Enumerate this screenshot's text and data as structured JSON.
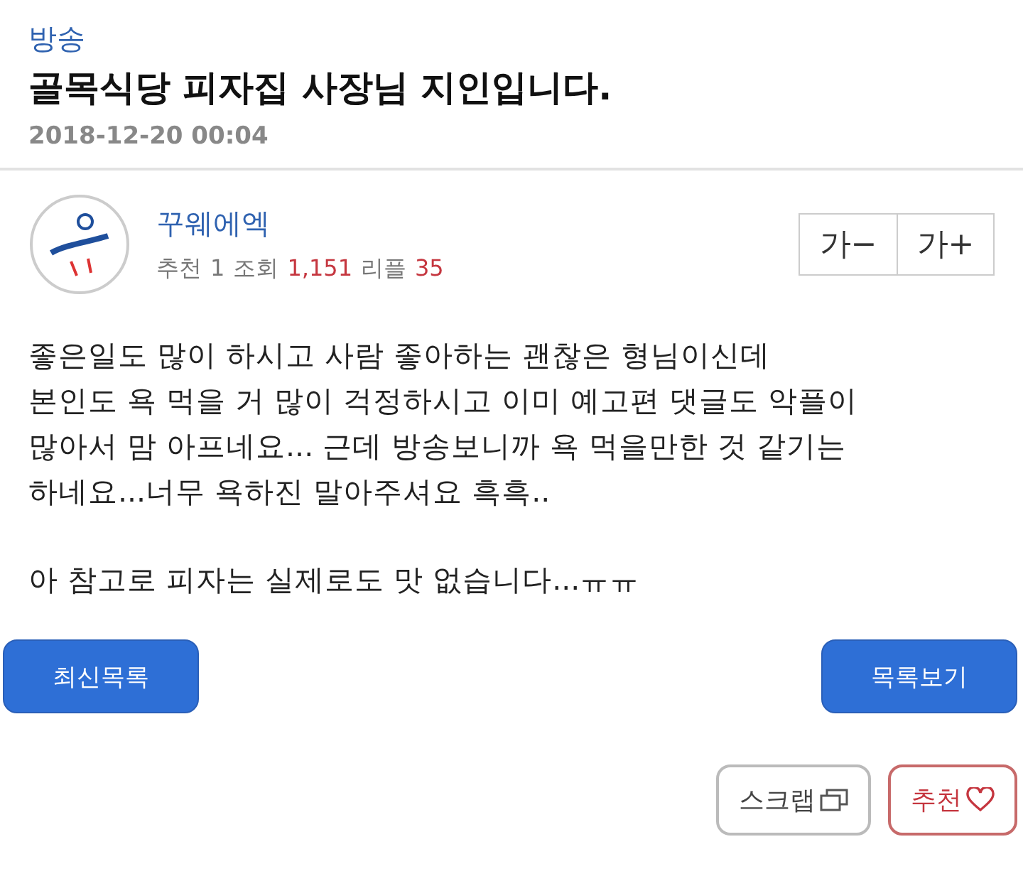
{
  "category": "방송",
  "title": "골목식당 피자집 사장님 지인입니다.",
  "date": "2018-12-20 00:04",
  "author": {
    "name": "꾸웨에엑",
    "stats": [
      {
        "label": "추천",
        "value": "1",
        "highlight": false
      },
      {
        "label": "조회",
        "value": "1,151",
        "highlight": true
      },
      {
        "label": "리플",
        "value": "35",
        "highlight": true
      }
    ]
  },
  "font_buttons": [
    "가−",
    "가+"
  ],
  "body": [
    {
      "lines": [
        "좋은일도 많이 하시고 사람 좋아하는 괜찮은 형님이신데",
        "본인도 욕 먹을 거 많이 걱정하시고 이미 예고편 댓글도 악플이",
        "많아서 맘 아프네요... 근데 방송보니까 욕 먹을만한 것 같기는",
        "하네요...너무 욕하진 말아주셔요 흑흑.."
      ]
    },
    {
      "lines": [
        "아 참고로 피자는 실제로도 맛 없습니다...ㅠㅠ"
      ]
    }
  ],
  "nav_buttons": [
    "최신목록",
    "목록보기"
  ],
  "actions": [
    {
      "kind": "scrap",
      "label": "스크랩"
    },
    {
      "kind": "recommend",
      "label": "추천"
    }
  ]
}
